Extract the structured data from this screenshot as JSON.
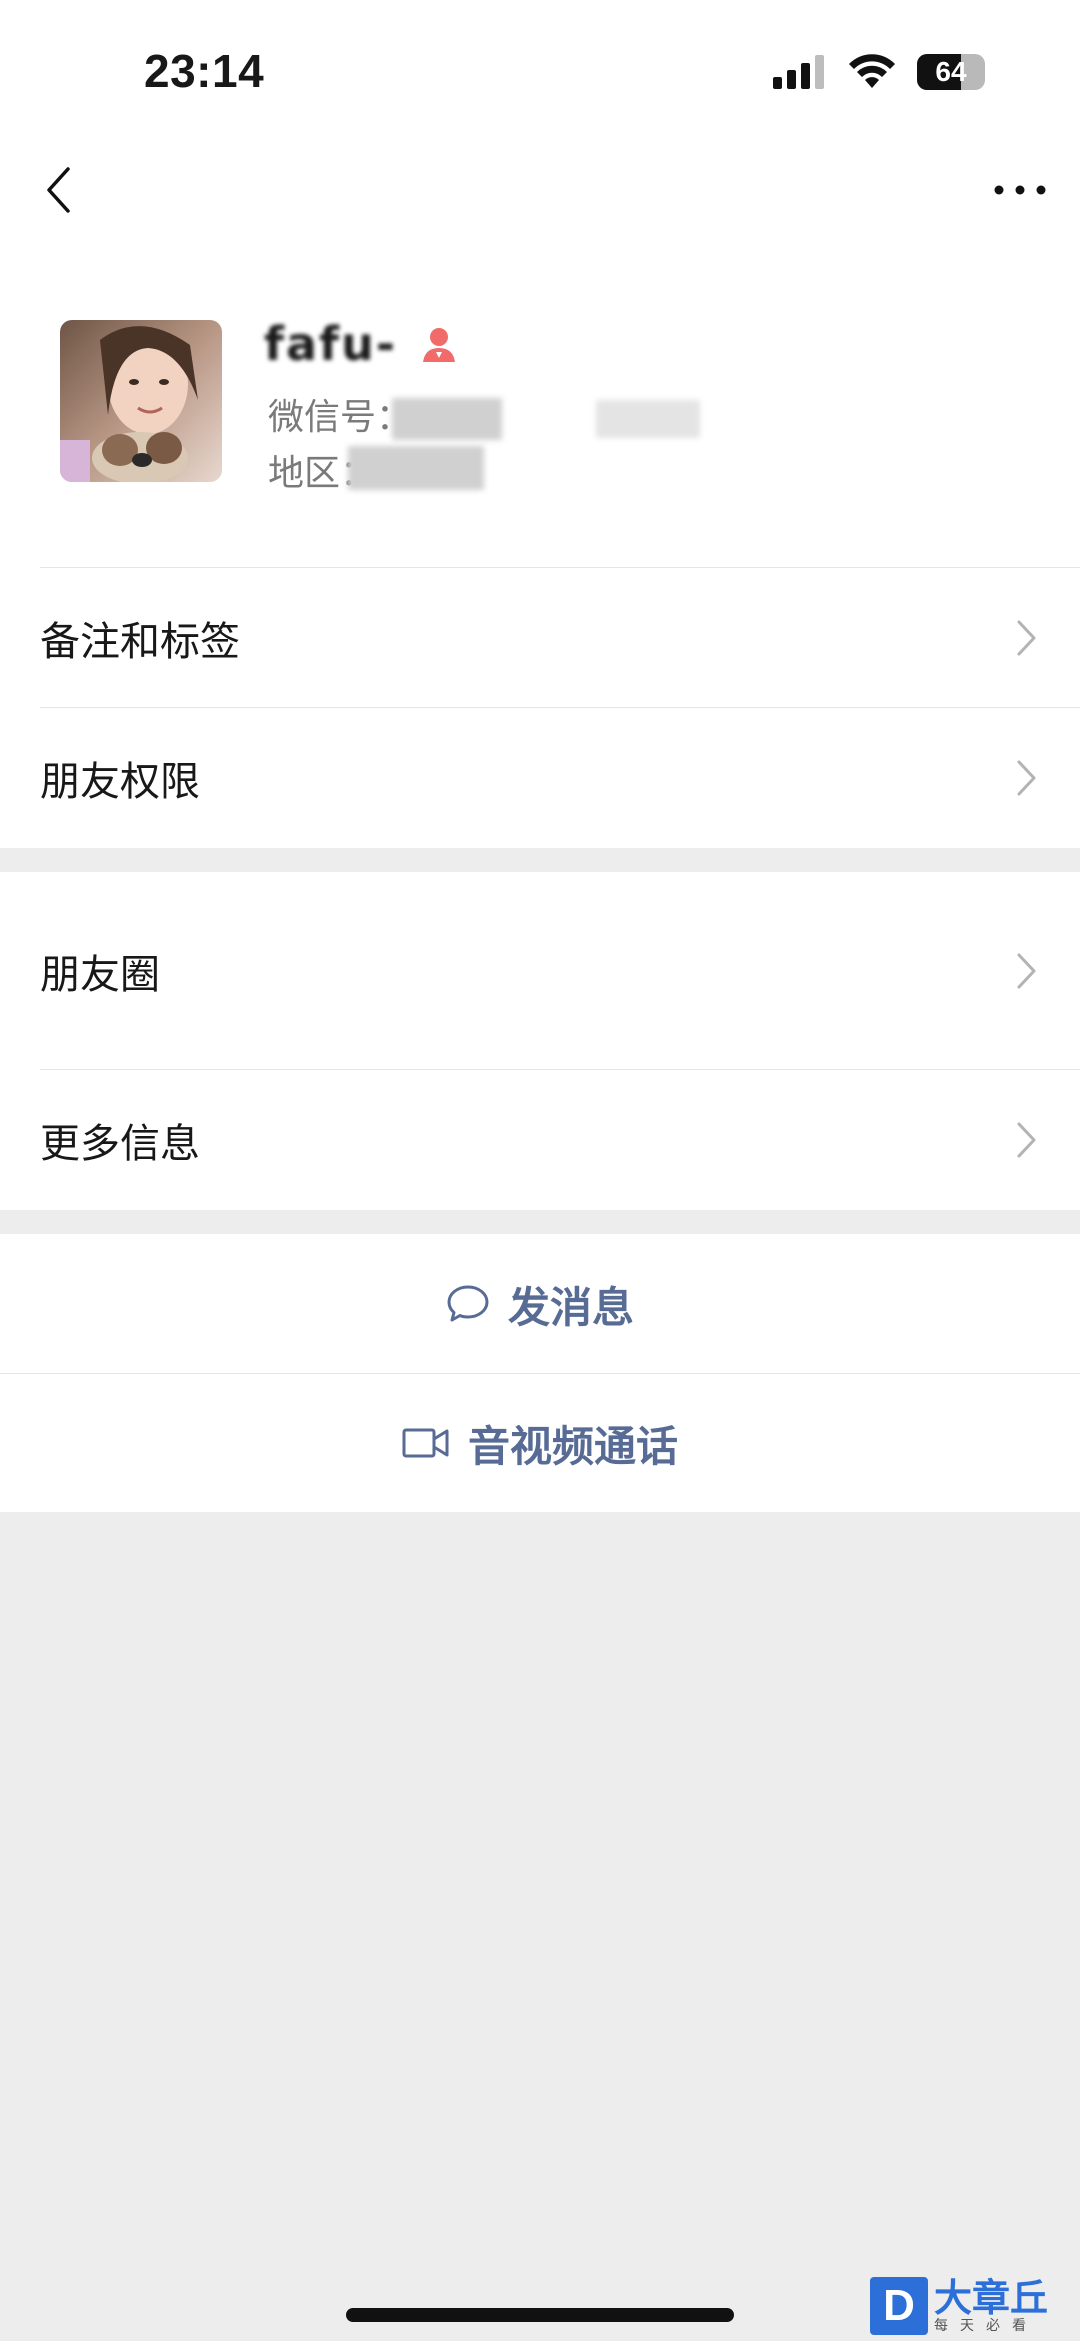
{
  "status_bar": {
    "time": "23:14",
    "battery": "64",
    "battery_level": 0.64
  },
  "nav": {
    "back_icon": "chevron-left-icon",
    "more_icon": "ellipsis-icon"
  },
  "profile": {
    "nickname": "fafu-",
    "gender_icon": "female-icon",
    "gender_color": "#f26b6b",
    "wechat_id_label": "微信号：",
    "region_label": "地区："
  },
  "menu_group_1": [
    {
      "label": "备注和标签"
    },
    {
      "label": "朋友权限"
    }
  ],
  "menu_group_2": [
    {
      "label": "朋友圈"
    },
    {
      "label": "更多信息"
    }
  ],
  "actions": {
    "message": {
      "label": "发消息",
      "icon": "chat-bubble-icon"
    },
    "call": {
      "label": "音视频通话",
      "icon": "video-camera-icon"
    }
  },
  "colors": {
    "link": "#576b95",
    "background": "#ededed"
  },
  "watermark": {
    "logo": "D",
    "name": "大章丘",
    "slogan": "每天必看"
  }
}
